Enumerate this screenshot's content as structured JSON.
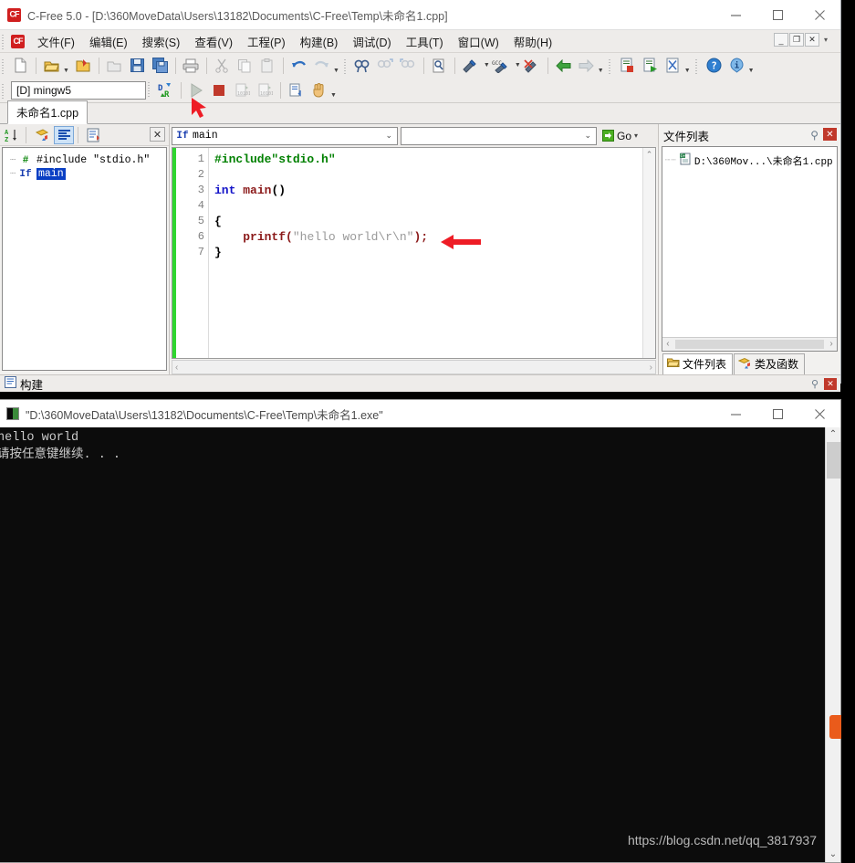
{
  "window": {
    "title": "C-Free 5.0 - [D:\\360MoveData\\Users\\13182\\Documents\\C-Free\\Temp\\未命名1.cpp]",
    "app_icon": "cf-logo-icon",
    "minimize": "—",
    "maximize": "□",
    "close": "✕"
  },
  "menubar": {
    "app_icon": "cf-logo-icon",
    "items": [
      {
        "label": "文件(F)",
        "key": "F"
      },
      {
        "label": "编辑(E)",
        "key": "E"
      },
      {
        "label": "搜索(S)",
        "key": "S"
      },
      {
        "label": "查看(V)",
        "key": "V"
      },
      {
        "label": "工程(P)",
        "key": "P"
      },
      {
        "label": "构建(B)",
        "key": "B"
      },
      {
        "label": "调试(D)",
        "key": "D"
      },
      {
        "label": "工具(T)",
        "key": "T"
      },
      {
        "label": "窗口(W)",
        "key": "W"
      },
      {
        "label": "帮助(H)",
        "key": "H"
      }
    ],
    "mdi_minimize": "_",
    "mdi_restore": "❐",
    "mdi_close": "✕",
    "overflow_caret": "▾"
  },
  "toolbar_row1": {
    "icons": [
      "new-file-icon",
      "open-folder-icon",
      "open-dropdown-caret",
      "new-project-icon",
      "close-project-icon",
      "save-icon",
      "save-all-icon",
      "print-icon",
      "cut-icon",
      "copy-icon",
      "paste-icon",
      "undo-icon",
      "redo-icon",
      "undo-dropdown-caret",
      "find-icon",
      "find-next-icon",
      "find-prev-icon",
      "find-in-files-icon"
    ],
    "icons_right": [
      "compile-icon",
      "compile-dropdown-caret",
      "build-icon",
      "build-dropdown-caret",
      "rebuild-icon",
      "nav-back-icon",
      "nav-forward-icon",
      "nav-dropdown-caret",
      "stop-build-icon",
      "run-build-icon",
      "clean-icon",
      "doc-dropdown-caret",
      "help-icon",
      "about-icon",
      "help-dropdown-caret"
    ]
  },
  "toolbar_row2": {
    "compiler_value": "[D] mingw5",
    "icons": [
      "debug-restart-icon",
      "run-icon",
      "stop-icon",
      "step-over-icon",
      "step-into-icon",
      "step-out-icon",
      "pause-icon",
      "debug-dropdown-caret"
    ]
  },
  "document_tabs": [
    {
      "label": "未命名1.cpp",
      "active": true
    }
  ],
  "left_pane": {
    "toolbar_icons": [
      "sort-az-icon",
      "class-function-icon",
      "member-list-icon",
      "properties-icon"
    ],
    "close_label": "✕",
    "tree": [
      {
        "icon": "hash-icon",
        "icon_glyph": "#",
        "icon_color": "#008000",
        "label": "#include \"stdio.h\"",
        "selected": false
      },
      {
        "icon": "function-icon",
        "icon_glyph": "If",
        "icon_color": "#1b3fb0",
        "label": "main",
        "selected": true
      }
    ]
  },
  "editor": {
    "symbol_combo": {
      "value": "main",
      "icon": "function-icon",
      "icon_glyph": "If",
      "chevron": "⌄"
    },
    "find_combo": {
      "value": "",
      "placeholder": "",
      "chevron": "⌄"
    },
    "go_button": {
      "label": "Go",
      "icon": "go-arrow-icon",
      "caret": "▾"
    },
    "line_numbers": [
      "1",
      "2",
      "3",
      "4",
      "5",
      "6",
      "7"
    ],
    "code_lines": [
      [
        {
          "t": "#include",
          "c": "k-pre"
        },
        {
          "t": "\"stdio.h\"",
          "c": "k-pre"
        }
      ],
      [],
      [
        {
          "t": "int",
          "c": "k-type"
        },
        {
          "t": " ",
          "c": ""
        },
        {
          "t": "main",
          "c": "k-fn"
        },
        {
          "t": "()",
          "c": "k-brace"
        }
      ],
      [],
      [
        {
          "t": "{",
          "c": "k-brace"
        }
      ],
      [
        {
          "t": "    ",
          "c": ""
        },
        {
          "t": "printf",
          "c": "k-fn"
        },
        {
          "t": "(",
          "c": "k-punct"
        },
        {
          "t": "\"hello world\\r\\n\"",
          "c": "k-str"
        },
        {
          "t": ");",
          "c": "k-punct"
        }
      ],
      [
        {
          "t": "}",
          "c": "k-brace"
        }
      ]
    ],
    "scroll_up": "⌃",
    "hscroll_left": "‹",
    "hscroll_right": "›"
  },
  "right_pane": {
    "title": "文件列表",
    "pin": "⚲",
    "close": "✕",
    "files": [
      {
        "icon": "cpp-file-icon",
        "label": "D:\\360Mov...\\未命名1.cpp"
      }
    ],
    "hscroll_left": "‹",
    "hscroll_right": "›",
    "tabs": [
      {
        "label": "文件列表",
        "icon": "folder-icon",
        "active": true
      },
      {
        "label": "类及函数",
        "icon": "class-function-icon",
        "active": false
      }
    ]
  },
  "build_bar": {
    "title": "构建",
    "icon": "build-panel-icon",
    "pin": "⚲",
    "close": "✕"
  },
  "console_window": {
    "title": "\"D:\\360MoveData\\Users\\13182\\Documents\\C-Free\\Temp\\未命名1.exe\"",
    "icon": "console-icon",
    "minimize": "—",
    "maximize": "□",
    "close": "✕",
    "output_lines": [
      "hello world",
      "请按任意键继续. . ."
    ],
    "scroll_up": "⌃",
    "scroll_down": "⌄"
  },
  "watermark": "https://blog.csdn.net/qq_3817937",
  "annotations": {
    "arrow_toolbar": "red-cursor-arrow",
    "arrow_code": "red-left-arrow",
    "color": "#ee1c25"
  }
}
